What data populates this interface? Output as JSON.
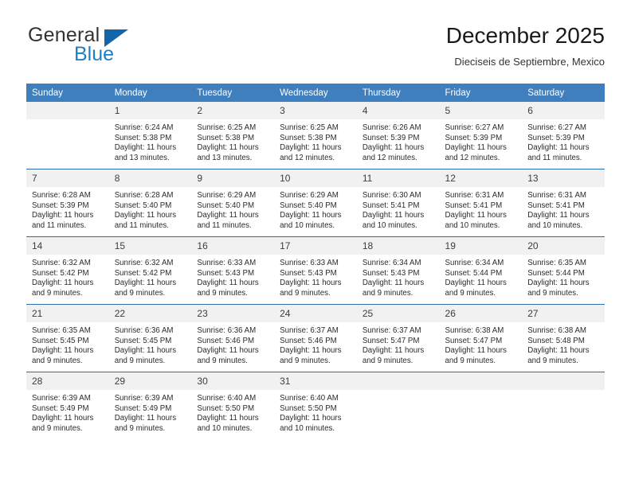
{
  "brand": {
    "name_part1": "General",
    "name_part2": "Blue",
    "triangle_icon": "triangle-icon",
    "accent_color": "#1265a8"
  },
  "header": {
    "title": "December 2025",
    "subtitle": "Dieciseis de Septiembre, Mexico"
  },
  "calendar": {
    "header_color": "#3f7fbe",
    "daynum_band_color": "#f1f1f1",
    "weekday_headers": [
      "Sunday",
      "Monday",
      "Tuesday",
      "Wednesday",
      "Thursday",
      "Friday",
      "Saturday"
    ],
    "weeks": [
      [
        {
          "day": "",
          "sunrise": "",
          "sunset": "",
          "daylight_line1": "",
          "daylight_line2": ""
        },
        {
          "day": "1",
          "sunrise": "Sunrise: 6:24 AM",
          "sunset": "Sunset: 5:38 PM",
          "daylight_line1": "Daylight: 11 hours",
          "daylight_line2": "and 13 minutes."
        },
        {
          "day": "2",
          "sunrise": "Sunrise: 6:25 AM",
          "sunset": "Sunset: 5:38 PM",
          "daylight_line1": "Daylight: 11 hours",
          "daylight_line2": "and 13 minutes."
        },
        {
          "day": "3",
          "sunrise": "Sunrise: 6:25 AM",
          "sunset": "Sunset: 5:38 PM",
          "daylight_line1": "Daylight: 11 hours",
          "daylight_line2": "and 12 minutes."
        },
        {
          "day": "4",
          "sunrise": "Sunrise: 6:26 AM",
          "sunset": "Sunset: 5:39 PM",
          "daylight_line1": "Daylight: 11 hours",
          "daylight_line2": "and 12 minutes."
        },
        {
          "day": "5",
          "sunrise": "Sunrise: 6:27 AM",
          "sunset": "Sunset: 5:39 PM",
          "daylight_line1": "Daylight: 11 hours",
          "daylight_line2": "and 12 minutes."
        },
        {
          "day": "6",
          "sunrise": "Sunrise: 6:27 AM",
          "sunset": "Sunset: 5:39 PM",
          "daylight_line1": "Daylight: 11 hours",
          "daylight_line2": "and 11 minutes."
        }
      ],
      [
        {
          "day": "7",
          "sunrise": "Sunrise: 6:28 AM",
          "sunset": "Sunset: 5:39 PM",
          "daylight_line1": "Daylight: 11 hours",
          "daylight_line2": "and 11 minutes."
        },
        {
          "day": "8",
          "sunrise": "Sunrise: 6:28 AM",
          "sunset": "Sunset: 5:40 PM",
          "daylight_line1": "Daylight: 11 hours",
          "daylight_line2": "and 11 minutes."
        },
        {
          "day": "9",
          "sunrise": "Sunrise: 6:29 AM",
          "sunset": "Sunset: 5:40 PM",
          "daylight_line1": "Daylight: 11 hours",
          "daylight_line2": "and 11 minutes."
        },
        {
          "day": "10",
          "sunrise": "Sunrise: 6:29 AM",
          "sunset": "Sunset: 5:40 PM",
          "daylight_line1": "Daylight: 11 hours",
          "daylight_line2": "and 10 minutes."
        },
        {
          "day": "11",
          "sunrise": "Sunrise: 6:30 AM",
          "sunset": "Sunset: 5:41 PM",
          "daylight_line1": "Daylight: 11 hours",
          "daylight_line2": "and 10 minutes."
        },
        {
          "day": "12",
          "sunrise": "Sunrise: 6:31 AM",
          "sunset": "Sunset: 5:41 PM",
          "daylight_line1": "Daylight: 11 hours",
          "daylight_line2": "and 10 minutes."
        },
        {
          "day": "13",
          "sunrise": "Sunrise: 6:31 AM",
          "sunset": "Sunset: 5:41 PM",
          "daylight_line1": "Daylight: 11 hours",
          "daylight_line2": "and 10 minutes."
        }
      ],
      [
        {
          "day": "14",
          "sunrise": "Sunrise: 6:32 AM",
          "sunset": "Sunset: 5:42 PM",
          "daylight_line1": "Daylight: 11 hours",
          "daylight_line2": "and 9 minutes."
        },
        {
          "day": "15",
          "sunrise": "Sunrise: 6:32 AM",
          "sunset": "Sunset: 5:42 PM",
          "daylight_line1": "Daylight: 11 hours",
          "daylight_line2": "and 9 minutes."
        },
        {
          "day": "16",
          "sunrise": "Sunrise: 6:33 AM",
          "sunset": "Sunset: 5:43 PM",
          "daylight_line1": "Daylight: 11 hours",
          "daylight_line2": "and 9 minutes."
        },
        {
          "day": "17",
          "sunrise": "Sunrise: 6:33 AM",
          "sunset": "Sunset: 5:43 PM",
          "daylight_line1": "Daylight: 11 hours",
          "daylight_line2": "and 9 minutes."
        },
        {
          "day": "18",
          "sunrise": "Sunrise: 6:34 AM",
          "sunset": "Sunset: 5:43 PM",
          "daylight_line1": "Daylight: 11 hours",
          "daylight_line2": "and 9 minutes."
        },
        {
          "day": "19",
          "sunrise": "Sunrise: 6:34 AM",
          "sunset": "Sunset: 5:44 PM",
          "daylight_line1": "Daylight: 11 hours",
          "daylight_line2": "and 9 minutes."
        },
        {
          "day": "20",
          "sunrise": "Sunrise: 6:35 AM",
          "sunset": "Sunset: 5:44 PM",
          "daylight_line1": "Daylight: 11 hours",
          "daylight_line2": "and 9 minutes."
        }
      ],
      [
        {
          "day": "21",
          "sunrise": "Sunrise: 6:35 AM",
          "sunset": "Sunset: 5:45 PM",
          "daylight_line1": "Daylight: 11 hours",
          "daylight_line2": "and 9 minutes."
        },
        {
          "day": "22",
          "sunrise": "Sunrise: 6:36 AM",
          "sunset": "Sunset: 5:45 PM",
          "daylight_line1": "Daylight: 11 hours",
          "daylight_line2": "and 9 minutes."
        },
        {
          "day": "23",
          "sunrise": "Sunrise: 6:36 AM",
          "sunset": "Sunset: 5:46 PM",
          "daylight_line1": "Daylight: 11 hours",
          "daylight_line2": "and 9 minutes."
        },
        {
          "day": "24",
          "sunrise": "Sunrise: 6:37 AM",
          "sunset": "Sunset: 5:46 PM",
          "daylight_line1": "Daylight: 11 hours",
          "daylight_line2": "and 9 minutes."
        },
        {
          "day": "25",
          "sunrise": "Sunrise: 6:37 AM",
          "sunset": "Sunset: 5:47 PM",
          "daylight_line1": "Daylight: 11 hours",
          "daylight_line2": "and 9 minutes."
        },
        {
          "day": "26",
          "sunrise": "Sunrise: 6:38 AM",
          "sunset": "Sunset: 5:47 PM",
          "daylight_line1": "Daylight: 11 hours",
          "daylight_line2": "and 9 minutes."
        },
        {
          "day": "27",
          "sunrise": "Sunrise: 6:38 AM",
          "sunset": "Sunset: 5:48 PM",
          "daylight_line1": "Daylight: 11 hours",
          "daylight_line2": "and 9 minutes."
        }
      ],
      [
        {
          "day": "28",
          "sunrise": "Sunrise: 6:39 AM",
          "sunset": "Sunset: 5:49 PM",
          "daylight_line1": "Daylight: 11 hours",
          "daylight_line2": "and 9 minutes."
        },
        {
          "day": "29",
          "sunrise": "Sunrise: 6:39 AM",
          "sunset": "Sunset: 5:49 PM",
          "daylight_line1": "Daylight: 11 hours",
          "daylight_line2": "and 9 minutes."
        },
        {
          "day": "30",
          "sunrise": "Sunrise: 6:40 AM",
          "sunset": "Sunset: 5:50 PM",
          "daylight_line1": "Daylight: 11 hours",
          "daylight_line2": "and 10 minutes."
        },
        {
          "day": "31",
          "sunrise": "Sunrise: 6:40 AM",
          "sunset": "Sunset: 5:50 PM",
          "daylight_line1": "Daylight: 11 hours",
          "daylight_line2": "and 10 minutes."
        },
        {
          "day": "",
          "sunrise": "",
          "sunset": "",
          "daylight_line1": "",
          "daylight_line2": ""
        },
        {
          "day": "",
          "sunrise": "",
          "sunset": "",
          "daylight_line1": "",
          "daylight_line2": ""
        },
        {
          "day": "",
          "sunrise": "",
          "sunset": "",
          "daylight_line1": "",
          "daylight_line2": ""
        }
      ]
    ]
  }
}
